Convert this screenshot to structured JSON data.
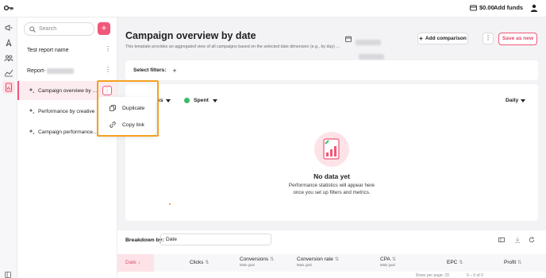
{
  "topbar": {
    "balance": "$0.00",
    "add_funds": "Add funds"
  },
  "leftpanel": {
    "search_placeholder": "Search",
    "add_label": "+",
    "groups": [
      {
        "label": "Test report name"
      },
      {
        "label": "Report-"
      }
    ],
    "reports": [
      {
        "label": "Campaign overview by da...",
        "active": true
      },
      {
        "label": "Performance by creative",
        "active": false
      },
      {
        "label": "Campaign performance b...",
        "active": false
      }
    ],
    "context_menu": [
      {
        "label": "Duplicate",
        "icon": "copy-icon"
      },
      {
        "label": "Copy link",
        "icon": "link-icon"
      }
    ]
  },
  "main": {
    "title": "Campaign overview by date",
    "description": "This template provides an aggregated view of all campaigns based on the selected date dimension (e.g., by day) ...",
    "add_comparison": "Add comparison",
    "more": "⋮",
    "save_as_new": "Save as new",
    "filters_label": "Select filters:",
    "filters_add": "+",
    "metric_left": "ks",
    "metric_spent": "Spent",
    "period": "Daily",
    "empty_title": "No data yet",
    "empty_line1": "Performance statistics will appear here",
    "empty_line2": "once you set up filters and metrics."
  },
  "breakdown": {
    "label": "Breakdown by:",
    "value": "Date"
  },
  "table": {
    "columns": [
      {
        "label": "Date",
        "sub": "",
        "sort": "↓"
      },
      {
        "label": "Clicks",
        "sub": "",
        "sort": "⇅"
      },
      {
        "label": "Conversions",
        "sub": "Main goal",
        "sort": "⇅"
      },
      {
        "label": "Conversion rate",
        "sub": "Main goal",
        "sort": "⇅"
      },
      {
        "label": "CPA",
        "sub": "Main goal",
        "sort": "⇅"
      },
      {
        "label": "EPC",
        "sub": "",
        "sort": "⇅"
      },
      {
        "label": "Profit",
        "sub": "",
        "sort": "⇅"
      }
    ],
    "rows_per_page": "Rows per page:",
    "rows_per_page_value": "20",
    "page_range": "0 – 0 of 0"
  },
  "colors": {
    "accent": "#f0587a",
    "highlight": "#f5a020",
    "spent_dot": "#3dbb6a"
  }
}
